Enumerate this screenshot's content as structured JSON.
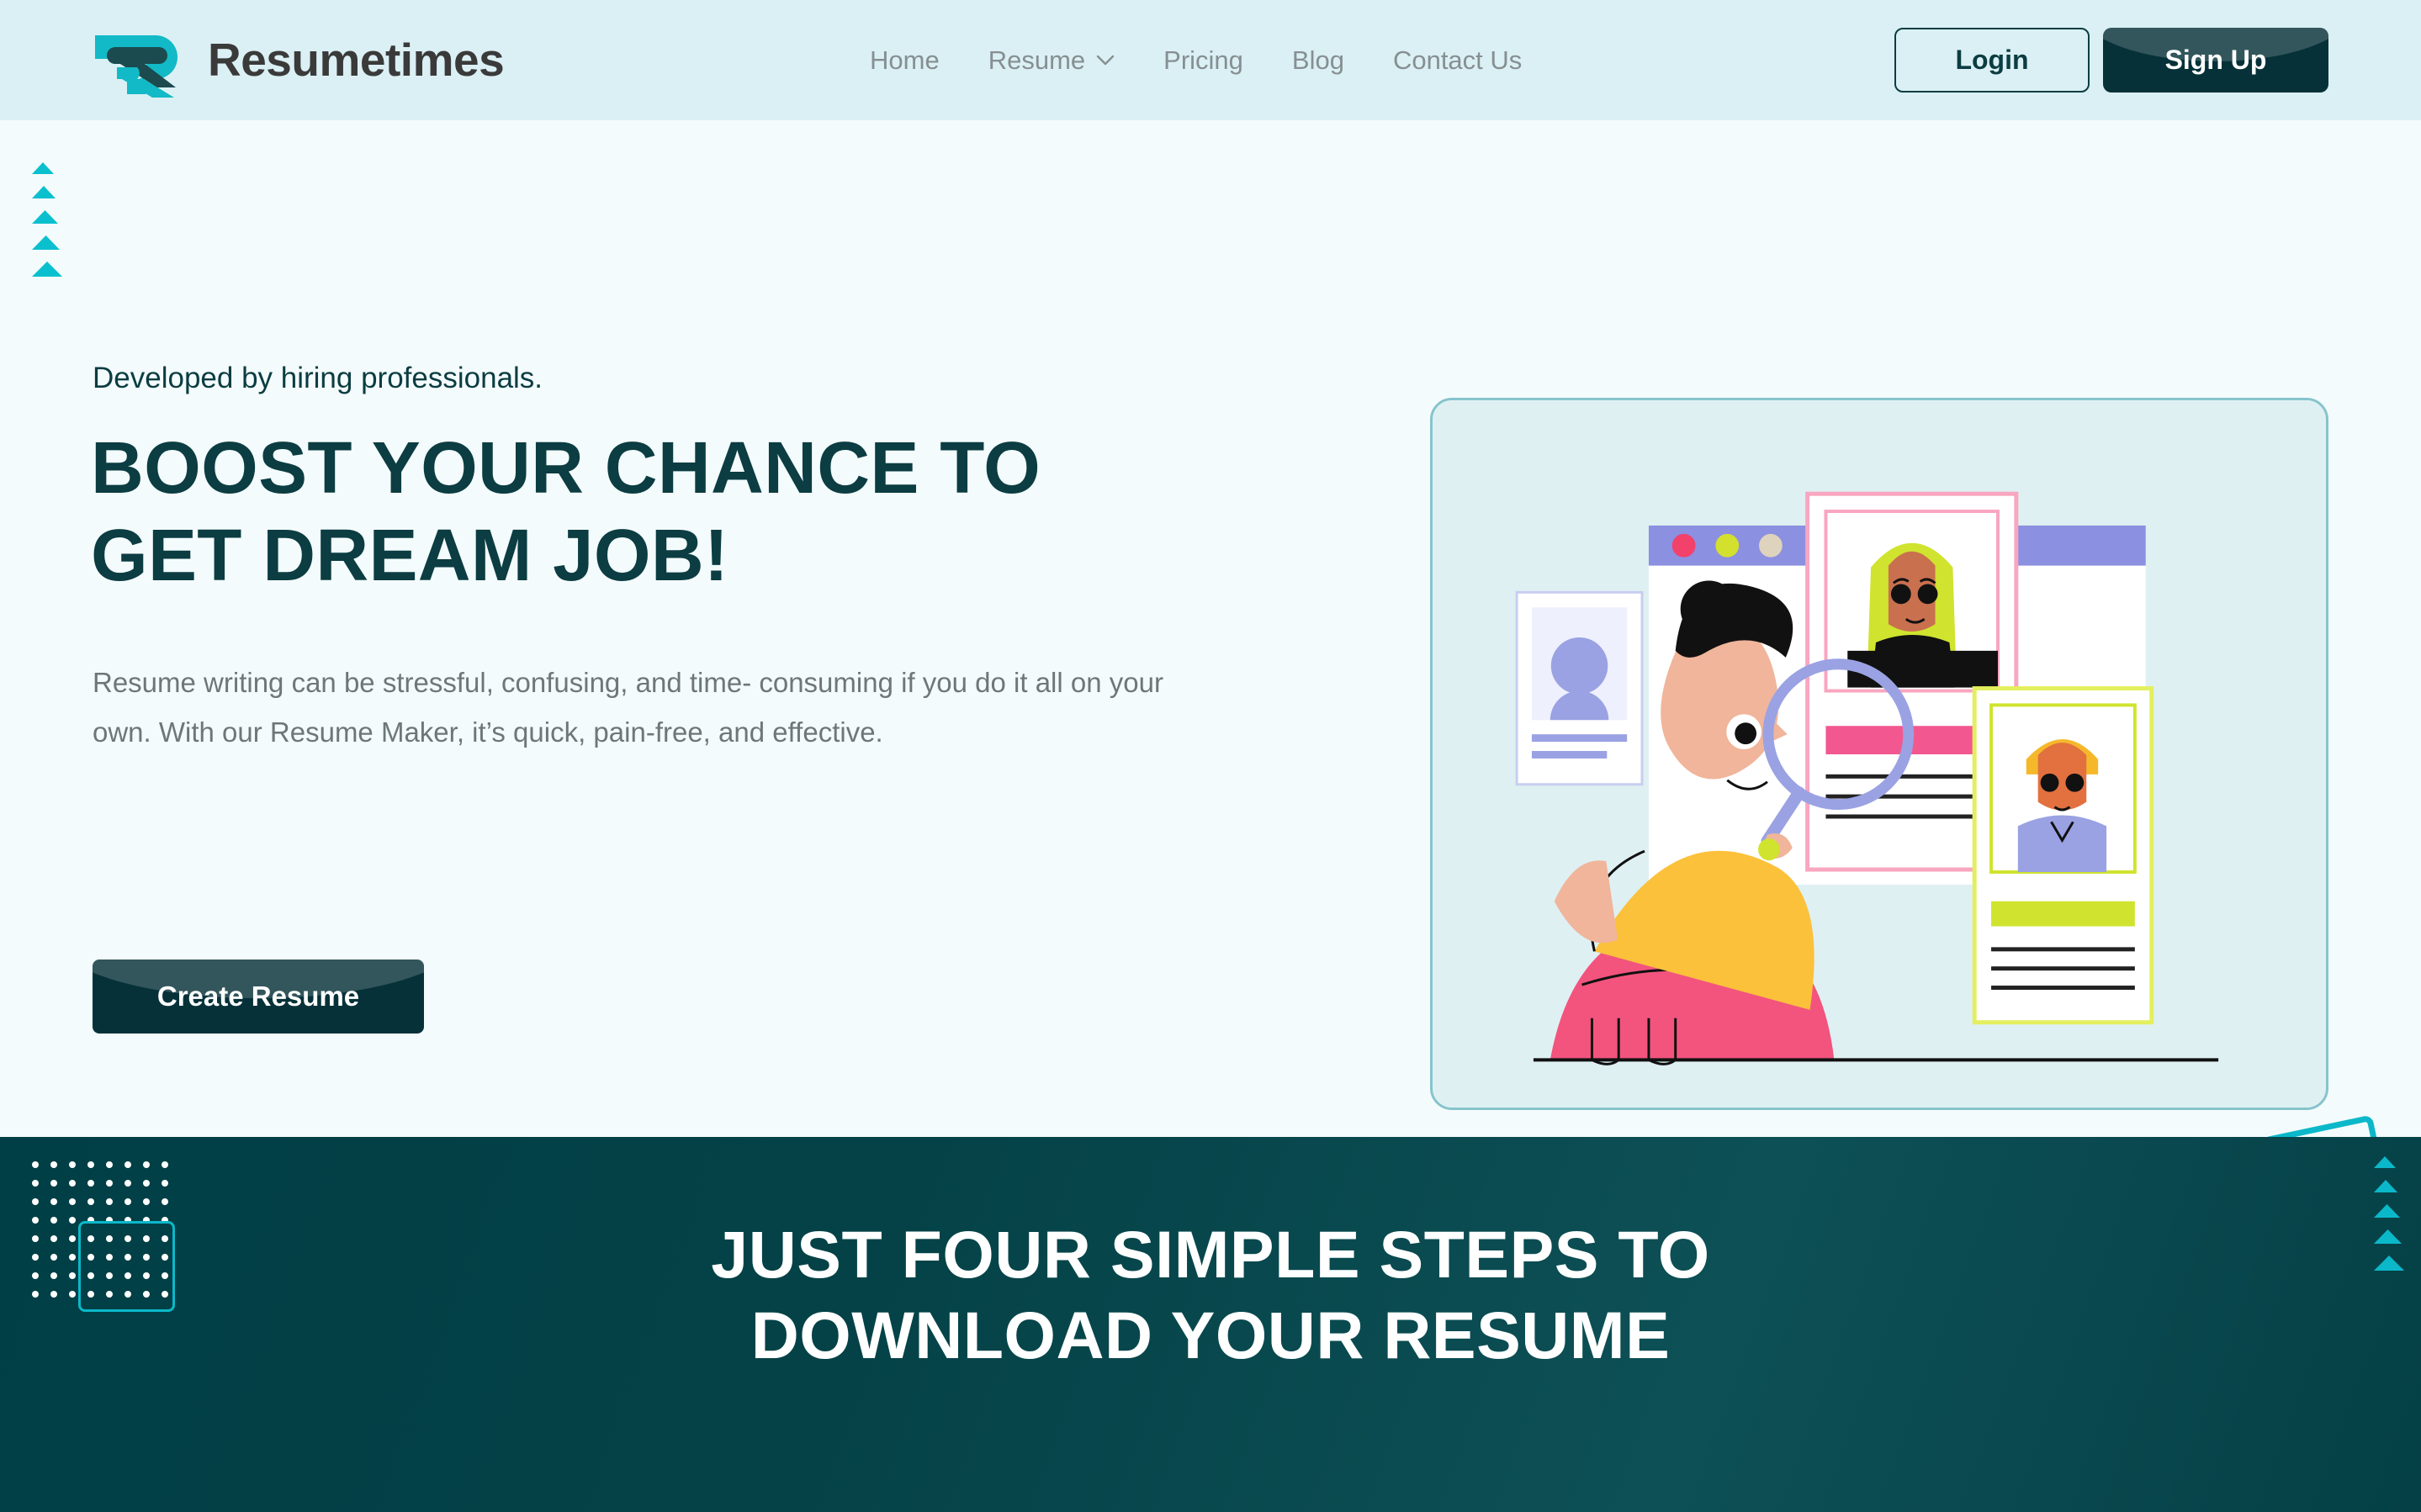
{
  "brand": {
    "name": "Resumetimes",
    "logo_icon": "resumetimes-r-logo-icon",
    "accent_cyan": "#0bb8c9",
    "accent_dark": "#0b3d42"
  },
  "header": {
    "background": "#dbf0f4",
    "nav": [
      {
        "label": "Home",
        "has_dropdown": false
      },
      {
        "label": "Resume",
        "has_dropdown": true,
        "icon": "chevron-down-icon"
      },
      {
        "label": "Pricing",
        "has_dropdown": false
      },
      {
        "label": "Blog",
        "has_dropdown": false
      },
      {
        "label": "Contact Us",
        "has_dropdown": false
      }
    ],
    "login_label": "Login",
    "signup_label": "Sign Up"
  },
  "hero": {
    "kicker": "Developed by hiring professionals.",
    "title_line1": "BOOST YOUR CHANCE TO",
    "title_line2": "GET DREAM JOB!",
    "description": "Resume writing can be stressful, confusing, and time- consuming if you do it all on your own. With our Resume Maker, it’s quick, pain-free, and effective.",
    "cta_label": "Create Resume",
    "illustration": "woman-with-magnifier-reviewing-resumes-illustration",
    "decor_triangles": 5,
    "decor_square": "rotated-square-decoration"
  },
  "steps": {
    "title_line1": "JUST FOUR SIMPLE STEPS TO",
    "title_line2": "DOWNLOAD YOUR RESUME",
    "background": "#044247",
    "decor_dots_rows": 8,
    "decor_dots_cols": 8,
    "decor_triangles": 5
  }
}
